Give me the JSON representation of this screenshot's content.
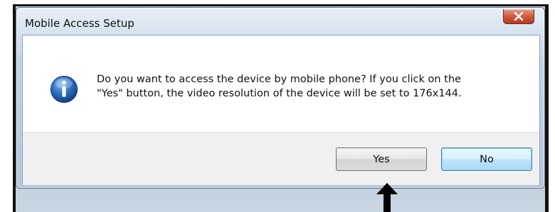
{
  "window": {
    "title": "Mobile Access Setup",
    "close_icon": "close-icon"
  },
  "dialog": {
    "icon": "info-icon",
    "message_line1": "Do you want to access the device by mobile phone? If you click on the",
    "message_line2": "\"Yes\" button, the video resolution of the device will be set to 176x144."
  },
  "buttons": {
    "yes_label": "Yes",
    "no_label": "No"
  },
  "annotation": {
    "arrow_icon": "up-arrow-icon"
  },
  "colors": {
    "close_button": "#cf5b3d",
    "default_button_border": "#3c7fb1",
    "info_icon": "#1f5fa8"
  }
}
